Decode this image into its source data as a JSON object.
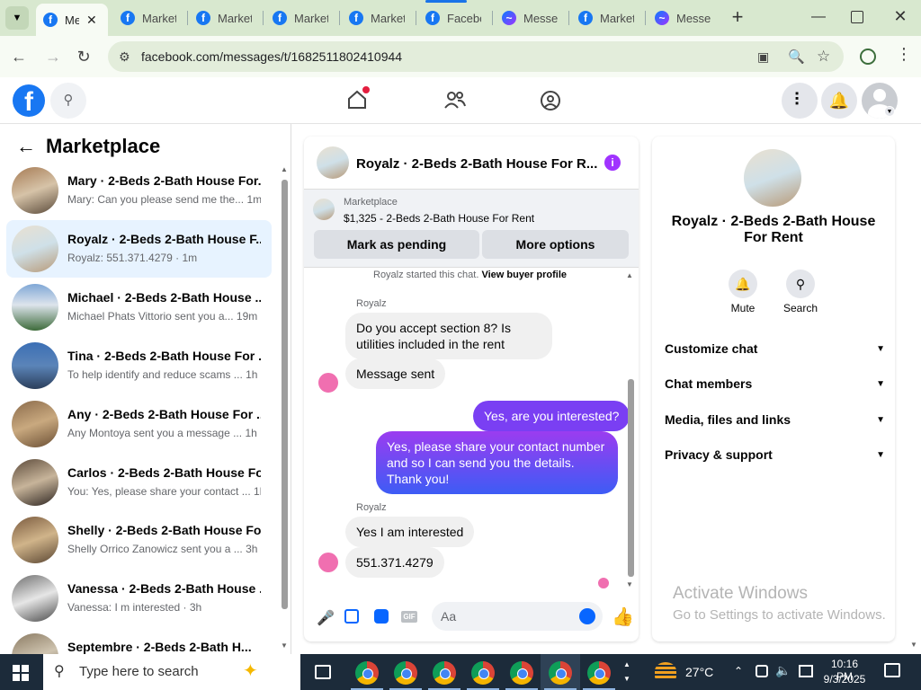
{
  "browser": {
    "tabs": [
      {
        "label": "Me",
        "active": true,
        "icon": "facebook-icon"
      },
      {
        "label": "Market",
        "icon": "facebook-icon"
      },
      {
        "label": "Market",
        "icon": "facebook-icon"
      },
      {
        "label": "Market",
        "icon": "facebook-icon"
      },
      {
        "label": "Market",
        "icon": "facebook-icon"
      },
      {
        "label": "Facebo",
        "icon": "facebook-icon"
      },
      {
        "label": "Messer",
        "icon": "messenger-icon"
      },
      {
        "label": "Market",
        "icon": "facebook-icon"
      },
      {
        "label": "Messer",
        "icon": "messenger-icon"
      }
    ],
    "url": "facebook.com/messages/t/1682511802410944"
  },
  "sidebar": {
    "title": "Marketplace",
    "conversations": [
      {
        "title": "Mary · 2-Beds 2-Bath House For...",
        "preview": "Mary: Can you please send me the...",
        "time": "1m"
      },
      {
        "title": "Royalz · 2-Beds 2-Bath House F...",
        "preview": "Royalz: 551.371.4279",
        "time": "1m",
        "selected": true
      },
      {
        "title": "Michael · 2-Beds 2-Bath House ...",
        "preview": "Michael Phats Vittorio sent you a...",
        "time": "19m"
      },
      {
        "title": "Tina · 2-Beds 2-Bath House For ...",
        "preview": "To help identify and reduce scams ...",
        "time": "1h"
      },
      {
        "title": "Any · 2-Beds 2-Bath House For ...",
        "preview": "Any Montoya sent you a message ...",
        "time": "1h"
      },
      {
        "title": "Carlos · 2-Beds 2-Bath House Fo...",
        "preview": "You: Yes, please share your contact ...",
        "time": "1h"
      },
      {
        "title": "Shelly · 2-Beds 2-Bath House Fo...",
        "preview": "Shelly Orrico Zanowicz sent you a ...",
        "time": "3h"
      },
      {
        "title": "Vanessa · 2-Beds 2-Bath House ...",
        "preview": "Vanessa: I m interested",
        "time": "3h"
      },
      {
        "title": "Septembre · 2-Beds 2-Bath H...",
        "preview": "",
        "time": ""
      }
    ]
  },
  "chat": {
    "header_title": "Royalz · 2-Beds 2-Bath House For R...",
    "listing_source": "Marketplace",
    "listing_title": "$1,325 - 2-Beds 2-Bath House For Rent",
    "btn_pending": "Mark as pending",
    "btn_more": "More options",
    "started_text": "Royalz started this chat.",
    "view_profile": "View buyer profile",
    "sender_name": "Royalz",
    "messages": {
      "m1": "Do you accept section 8? Is utilities included in the rent",
      "m2": "Message sent",
      "m3": "Yes, are you interested?",
      "m4": "Yes, please share your contact number and so I can send you the details. Thank you!",
      "m5": "Yes I am interested",
      "m6": "551.371.4279"
    },
    "input_placeholder": "Aa"
  },
  "rpanel": {
    "title": "Royalz · 2-Beds 2-Bath House For Rent",
    "mute_label": "Mute",
    "search_label": "Search",
    "sections": [
      "Customize chat",
      "Chat members",
      "Media, files and links",
      "Privacy & support"
    ],
    "watermark_title": "Activate Windows",
    "watermark_sub": "Go to Settings to activate Windows."
  },
  "taskbar": {
    "search_placeholder": "Type here to search",
    "weather": "27°C",
    "time": "10:16 PM",
    "date": "9/3/2025"
  },
  "colors": {
    "facebook_blue": "#1877f2",
    "selected_bg": "#e7f3ff",
    "bubble_out_top": "#9b3cf0",
    "bubble_out_bottom": "#3d5cf5",
    "taskbar_bg": "#1c2b3a"
  }
}
